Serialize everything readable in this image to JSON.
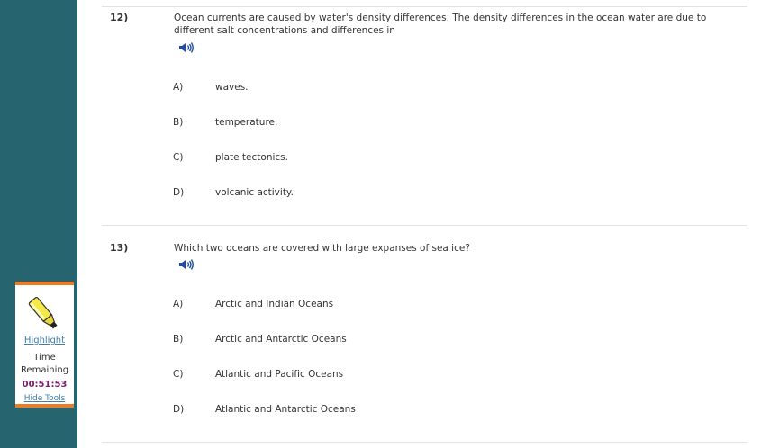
{
  "tools": {
    "highlight_label": "Highlight",
    "time_label": "Time Remaining",
    "time_value": "00:51:53",
    "hide_tools_label": "Hide Tools"
  },
  "questions": [
    {
      "number": "12)",
      "text": "Ocean currents are caused by water's density differences. The density differences in the ocean water are due to different salt concentrations and differences in",
      "options": [
        {
          "letter": "A)",
          "text": "waves."
        },
        {
          "letter": "B)",
          "text": "temperature."
        },
        {
          "letter": "C)",
          "text": "plate tectonics."
        },
        {
          "letter": "D)",
          "text": "volcanic activity."
        }
      ]
    },
    {
      "number": "13)",
      "text": "Which two oceans are covered with large expanses of sea ice?",
      "options": [
        {
          "letter": "A)",
          "text": "Arctic and Indian Oceans"
        },
        {
          "letter": "B)",
          "text": "Arctic and Antarctic Oceans"
        },
        {
          "letter": "C)",
          "text": "Atlantic and Pacific Oceans"
        },
        {
          "letter": "D)",
          "text": "Atlantic and Antarctic Oceans"
        }
      ]
    }
  ],
  "colors": {
    "sidebar": "#266570",
    "tools_border": "#f07b22",
    "timer": "#7b1f6b",
    "link": "#3a7fb4"
  }
}
